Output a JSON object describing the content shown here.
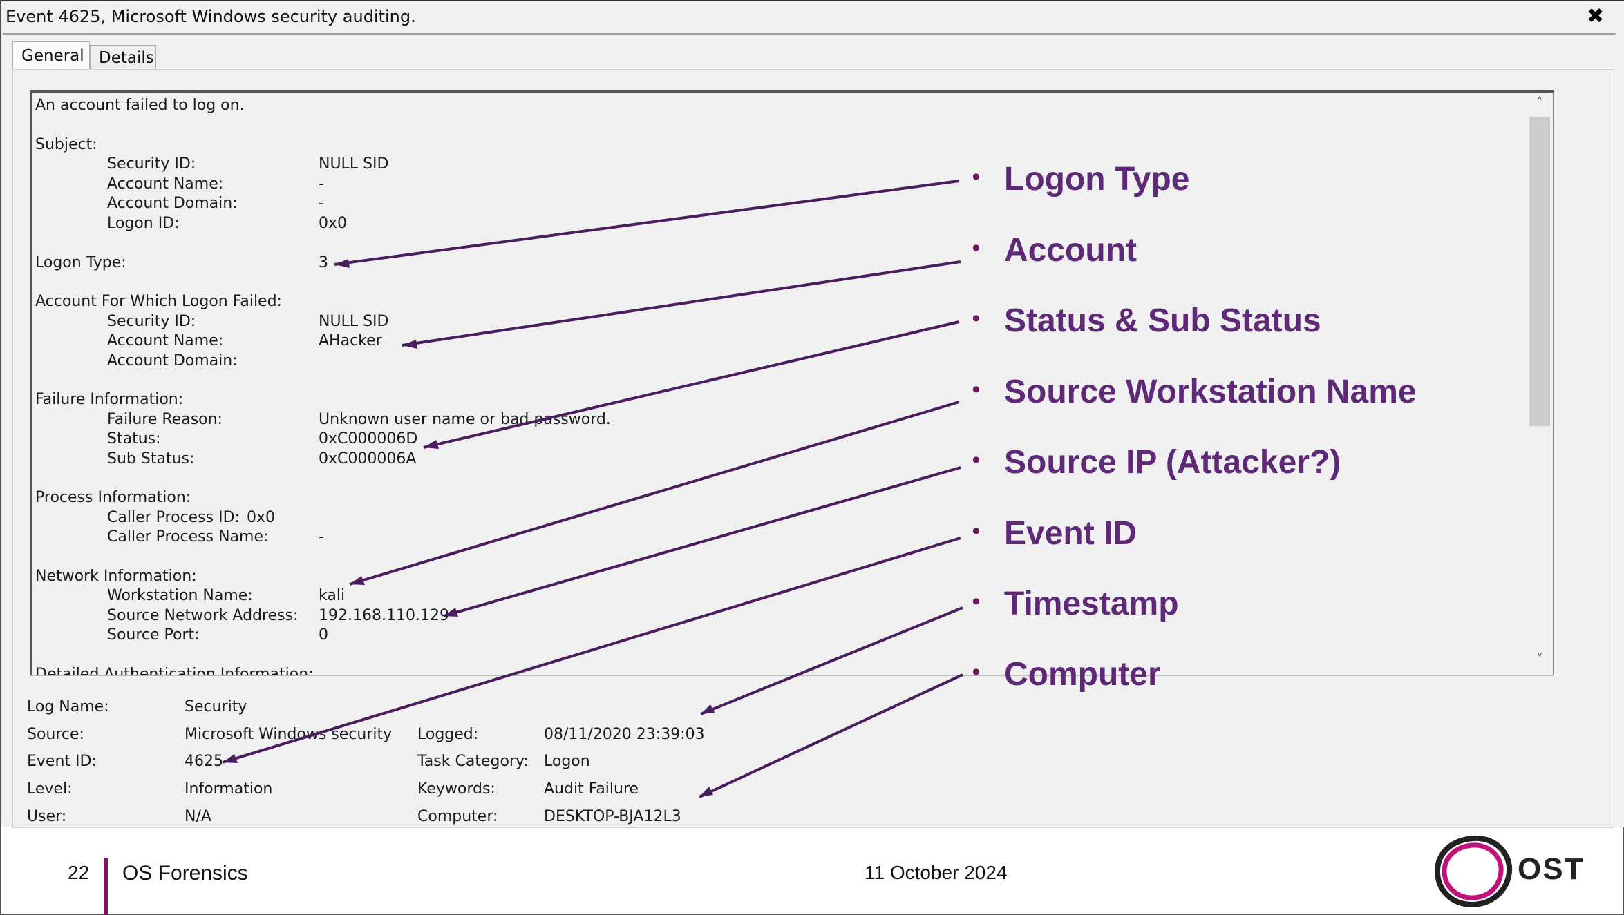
{
  "window": {
    "title": "Event 4625, Microsoft Windows security auditing.",
    "close_glyph": "✖",
    "tabs": [
      {
        "label": "General",
        "active": true
      },
      {
        "label": "Details",
        "active": false
      }
    ]
  },
  "message": {
    "lines": [
      {
        "l": "An account failed to log on.",
        "v": ""
      },
      {
        "l": "Subject:",
        "v": ""
      },
      {
        "l": "Security ID:",
        "v": "NULL SID"
      },
      {
        "l": "Account Name:",
        "v": "-"
      },
      {
        "l": "Account Domain:",
        "v": "-"
      },
      {
        "l": "Logon ID:",
        "v": "0x0"
      },
      {
        "l": "Logon Type:",
        "v": "3"
      },
      {
        "l": "Account For Which Logon Failed:",
        "v": ""
      },
      {
        "l": "Security ID:",
        "v": "NULL SID"
      },
      {
        "l": "Account Name:",
        "v": "AHacker"
      },
      {
        "l": "Account Domain:",
        "v": ""
      },
      {
        "l": "Failure Information:",
        "v": ""
      },
      {
        "l": "Failure Reason:",
        "v": "Unknown user name or bad password."
      },
      {
        "l": "Status:",
        "v": "0xC000006D"
      },
      {
        "l": "Sub Status:",
        "v": "0xC000006A"
      },
      {
        "l": "Process Information:",
        "v": ""
      },
      {
        "l": "Caller Process ID:",
        "v": "0x0"
      },
      {
        "l": "Caller Process Name:",
        "v": "-"
      },
      {
        "l": "Network Information:",
        "v": ""
      },
      {
        "l": "Workstation Name:",
        "v": "kali"
      },
      {
        "l": "Source Network Address:",
        "v": "192.168.110.129"
      },
      {
        "l": "Source Port:",
        "v": "0"
      },
      {
        "l": "Detailed Authentication Information:",
        "v": ""
      }
    ],
    "scroll_up": "˄",
    "scroll_down": "˅"
  },
  "details": {
    "log_name_label": "Log Name:",
    "log_name": "Security",
    "source_label": "Source:",
    "source": "Microsoft Windows security",
    "event_id_label": "Event ID:",
    "event_id": "4625",
    "level_label": "Level:",
    "level": "Information",
    "user_label": "User:",
    "user": "N/A",
    "logged_label": "Logged:",
    "logged": "08/11/2020 23:39:03",
    "task_label": "Task Category:",
    "task": "Logon",
    "keywords_label": "Keywords:",
    "keywords": "Audit Failure",
    "computer_label": "Computer:",
    "computer": "DESKTOP-BJA12L3"
  },
  "annotations": {
    "bullet": "•",
    "items": [
      "Logon Type",
      "Account",
      "Status & Sub Status",
      "Source Workstation Name",
      "Source IP (Attacker?)",
      "Event ID",
      "Timestamp",
      "Computer"
    ],
    "color": "#5e2a77"
  },
  "footer": {
    "page": "22",
    "title": "OS Forensics",
    "date": "11 October 2024",
    "logo_text": "OST",
    "accent": "#7a1660"
  }
}
